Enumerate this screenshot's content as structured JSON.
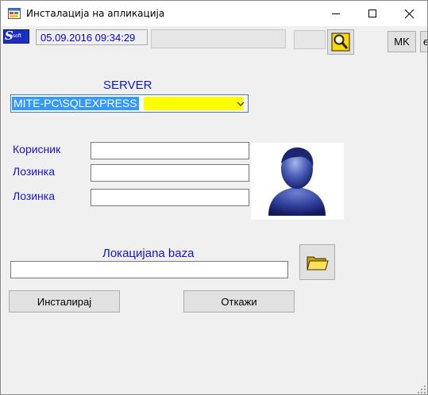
{
  "window": {
    "title": "Инсталација на апликација",
    "icon": "app-window-icon",
    "controls": {
      "minimize": "minimize-icon",
      "maximize": "maximize-icon",
      "close": "close-icon"
    }
  },
  "toolbar": {
    "logo": {
      "big": "S",
      "small": "soft"
    },
    "datetime": "05.09.2016 09:34:29",
    "search_icon": "magnifier-icon",
    "mk_label": "MK",
    "extra_label": "e"
  },
  "server": {
    "label": "SERVER",
    "value": "MITE-PC\\SQLEXPRESS"
  },
  "credentials": {
    "user_label": "Корисник",
    "password_label": "Лозинка",
    "password_confirm_label": "Лозинка",
    "user_value": "",
    "password_value": "",
    "password_confirm_value": ""
  },
  "location": {
    "label": "Локацијana baza",
    "value": "",
    "browse_icon": "folder-icon"
  },
  "actions": {
    "install_label": "Инсталирај",
    "cancel_label": "Откажи"
  },
  "colors": {
    "label_blue": "#1414c8",
    "selection_blue": "#3399ff",
    "highlight_yellow": "#ffff00",
    "logo_blue": "#1a2fbf"
  }
}
